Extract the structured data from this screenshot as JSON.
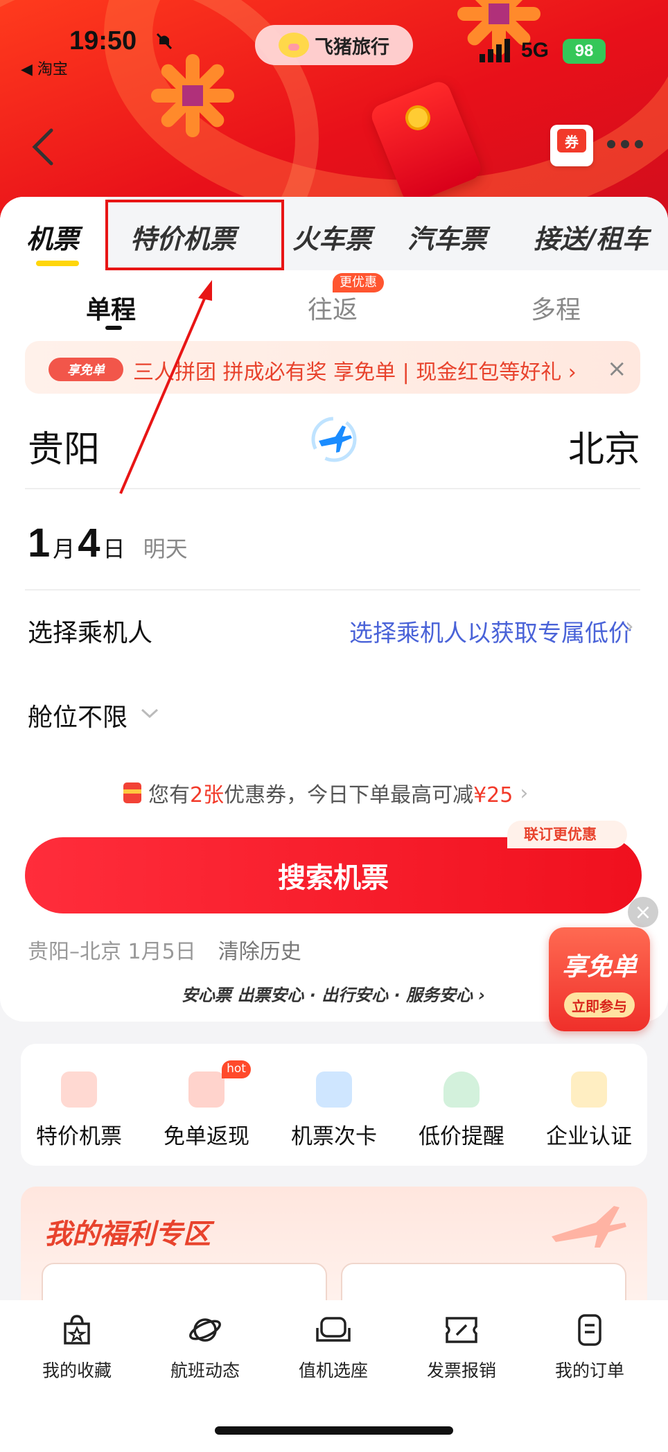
{
  "status_bar": {
    "time": "19:50",
    "back_app": "◀ 淘宝",
    "network": "5G",
    "battery": "98"
  },
  "header": {
    "brand": "飞猪旅行",
    "coupon_icon_text": "券"
  },
  "tabs": [
    {
      "label": "机票"
    },
    {
      "label": "特价机票"
    },
    {
      "label": "火车票"
    },
    {
      "label": "汽车票"
    },
    {
      "label": "接送/租车"
    }
  ],
  "trip_types": {
    "one_way": "单程",
    "round_trip": "往返",
    "multi": "多程",
    "round_badge": "更优惠"
  },
  "promo": {
    "tag": "享免单",
    "text": "三人拼团 拼成必有奖 享免单 | 现金红包等好礼 ›",
    "close": "×"
  },
  "route": {
    "from": "贵阳",
    "to": "北京"
  },
  "date": {
    "month": "1",
    "month_unit": "月",
    "day": "4",
    "day_unit": "日",
    "relative": "明天"
  },
  "passenger": {
    "label": "选择乘机人",
    "hint": "选择乘机人以获取专属低价"
  },
  "cabin": {
    "label": "舱位不限"
  },
  "coupon_line": {
    "prefix": "您有",
    "count": "2张",
    "middle": "优惠券，今日下单最高可减",
    "amount": "¥25"
  },
  "search": {
    "label": "搜索机票",
    "badge": "联订更优惠"
  },
  "history": {
    "item": "贵阳–北京 1月5日",
    "clear": "清除历史"
  },
  "assurance": {
    "text": "安心票 出票安心 · 出行安心 · 服务安心 ›"
  },
  "free_float": {
    "title": "享免单",
    "button": "立即参与"
  },
  "quick_entries": [
    {
      "label": "特价机票",
      "color": "#ff8a7a"
    },
    {
      "label": "免单返现",
      "color": "#ff9a8a",
      "badge": "hot"
    },
    {
      "label": "机票次卡",
      "color": "#6fb6ff"
    },
    {
      "label": "低价提醒",
      "color": "#6fd08a"
    },
    {
      "label": "企业认证",
      "color": "#ffcf6a"
    }
  ],
  "welfare": {
    "title": "我的福利专区"
  },
  "bottom_nav": [
    {
      "label": "我的收藏"
    },
    {
      "label": "航班动态"
    },
    {
      "label": "值机选座"
    },
    {
      "label": "发票报销"
    },
    {
      "label": "我的订单"
    }
  ]
}
